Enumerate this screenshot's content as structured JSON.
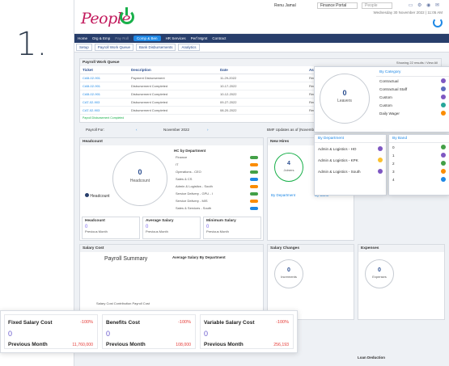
{
  "slide": {
    "number": "1."
  },
  "app": {
    "logo": "People",
    "user": "Renu Jamal",
    "portal": "Finance Portal",
    "search_placeholder": "People",
    "datetime": "Wednesday 30 November 2022 | 11:05 AM",
    "nav": [
      "Home",
      "Org & Emp",
      "Pay Roll",
      "Comp & Ben",
      "HR Services",
      "Perf Mgmt",
      "Contract"
    ],
    "active_nav": "Comp & Ben",
    "subnav": [
      "Setup",
      "Payroll Work Queue",
      "Bank Disbursements",
      "Analytics"
    ]
  },
  "work_queue": {
    "title": "Payroll Work Queue",
    "showing": "Showing 22 results / View All",
    "headers": [
      "Ticket",
      "Description",
      "Date",
      "Assigned To"
    ],
    "rows": [
      [
        "CAB-02-901",
        "Payment Disbursement",
        "11-29-2022",
        "Renu Jamal"
      ],
      [
        "CAB-02-901",
        "Disbursement Completed",
        "10-17-2022",
        "Renu Jamal"
      ],
      [
        "CAB-02-901",
        "Disbursement Completed",
        "10-12-2022",
        "Renu Jamal"
      ],
      [
        "CAT-02-903",
        "Disbursement Completed",
        "09-27-2022",
        "Renu Jamal"
      ],
      [
        "CAT-02-903",
        "Disbursement Completed",
        "08-20-2022",
        "Renu Jamal"
      ]
    ],
    "legend": "Payroll Disbursement   Completed"
  },
  "payroll_for": {
    "label": "Payroll For:",
    "month": "November 2022",
    "bmf": "BMF Updates as of (November 2022)"
  },
  "headcount": {
    "title": "Headcount",
    "value": "0",
    "label": "Headcount",
    "legend": "Headcount",
    "by_dept_title": "HC by Department",
    "depts": [
      "Finance",
      "IT",
      "Operations - CEO",
      "Sales & CS",
      "Admin & Logistics - South",
      "Service Delivery - GPU - I",
      "Service Delivery - MIS",
      "Sales & Services - South"
    ],
    "cards": [
      {
        "title": "Headcount",
        "value": "0",
        "prev": "Previous Month"
      },
      {
        "title": "Average Salary",
        "value": "0",
        "prev": "Previous Month"
      },
      {
        "title": "Minimum Salary",
        "value": "0",
        "prev": "Previous Month"
      }
    ]
  },
  "new_hires": {
    "title": "New Hires",
    "value": "4",
    "label": "Joiners",
    "by_dept": "By Department",
    "by_band": "By Band"
  },
  "leavers_popup": {
    "value": "0",
    "label": "Leavers",
    "by_category": "By Category",
    "categories": [
      "Contractual",
      "Contractual Staff",
      "Custom",
      "Custom",
      "Daily Wager"
    ],
    "by_department": "By Department",
    "departments": [
      "Admin & Logistics - HO",
      "Admin & Logistics - KPK",
      "Admin & Logistics - South"
    ],
    "by_band": "By Band",
    "bands": [
      "0",
      "1",
      "2",
      "3",
      "4"
    ],
    "category_colors": [
      "#7e57c2",
      "#5c6bc0",
      "#7e57c2",
      "#26a69a",
      "#fb8c00"
    ]
  },
  "salary_cost": {
    "title": "Salary Cost",
    "summary": "Payroll Summary",
    "avg_by_dept": "Average Salary By Department",
    "tabs": "Salary Cost   Contribution   Payroll Cost"
  },
  "salary_changes": {
    "title": "Salary Changes",
    "value": "0",
    "label": "Increments"
  },
  "expenses": {
    "title": "Expenses",
    "value": "0",
    "label": "Expenses"
  },
  "float_cards": [
    {
      "title": "Fixed Salary Cost",
      "pct": "-100%",
      "value": "0",
      "prev": "Previous Month",
      "prev_val": "11,760,000"
    },
    {
      "title": "Benefits Cost",
      "pct": "-100%",
      "value": "0",
      "prev": "Previous Month",
      "prev_val": "108,000"
    },
    {
      "title": "Variable Salary Cost",
      "pct": "-100%",
      "value": "0",
      "prev": "Previous Month",
      "prev_val": "256,193"
    }
  ],
  "loan": {
    "title": "Loan Deduction"
  }
}
